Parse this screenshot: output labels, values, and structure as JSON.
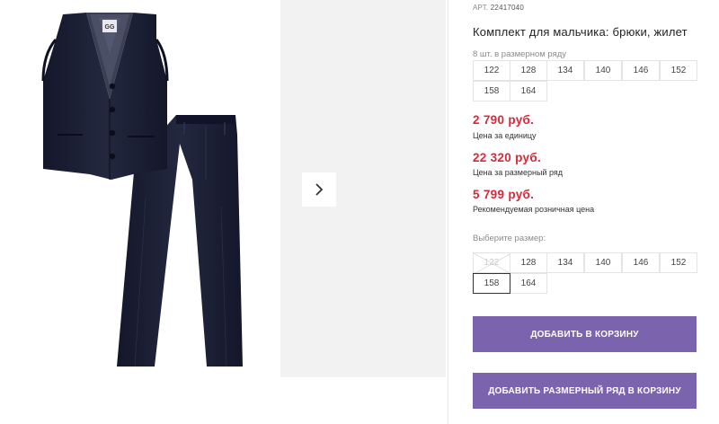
{
  "product": {
    "article_label": "АРТ.",
    "article_number": "22417040",
    "title": "Комплект для мальчика: брюки, жилет",
    "row_caption": "8 шт. в размерном ряду",
    "row_sizes": [
      "122",
      "128",
      "134",
      "140",
      "146",
      "152",
      "158",
      "164"
    ],
    "prices": [
      {
        "value": "2 790 руб.",
        "note": "Цена за единицу"
      },
      {
        "value": "22 320 руб.",
        "note": "Цена за размерный ряд"
      },
      {
        "value": "5 799 руб.",
        "note": "Рекомендуемая розничная цена"
      }
    ],
    "choose_size_label": "Выберите размер:",
    "choose_sizes": [
      {
        "label": "122",
        "state": "unavailable"
      },
      {
        "label": "128",
        "state": "available"
      },
      {
        "label": "134",
        "state": "available"
      },
      {
        "label": "140",
        "state": "available"
      },
      {
        "label": "146",
        "state": "available"
      },
      {
        "label": "152",
        "state": "available"
      },
      {
        "label": "158",
        "state": "selected"
      },
      {
        "label": "164",
        "state": "available"
      }
    ]
  },
  "actions": {
    "add_to_cart": "ДОБАВИТЬ В КОРЗИНУ",
    "add_row_to_cart": "ДОБАВИТЬ РАЗМЕРНЫЙ РЯД В КОРЗИНУ"
  },
  "gallery": {
    "main_image": "boys-vest-and-trousers-set",
    "brand_tag": "GG",
    "next_icon": "chevron-right-icon"
  },
  "colors": {
    "accent": "#7b63ad",
    "price": "#d12b3a",
    "garment": "#1a1d2e"
  }
}
